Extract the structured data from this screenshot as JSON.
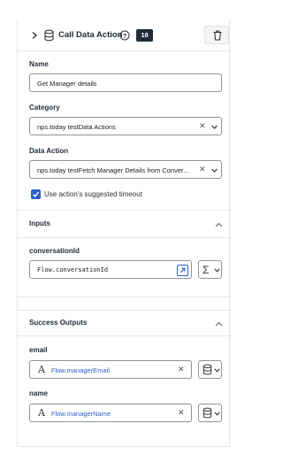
{
  "header": {
    "title": "Call Data Action",
    "badge": "18"
  },
  "form": {
    "name_label": "Name",
    "name_value": "Get Manager details",
    "category_label": "Category",
    "category_value": "nps.today testData Actions",
    "data_action_label": "Data Action",
    "data_action_value": "nps.today testFetch Manager Details from Conver...",
    "timeout_checked": true,
    "timeout_label": "Use action's suggested timeout"
  },
  "inputs": {
    "section_title": "Inputs",
    "items": [
      {
        "label": "conversationId",
        "value": "Flow.conversationId"
      }
    ]
  },
  "outputs": {
    "section_title": "Success Outputs",
    "items": [
      {
        "label": "email",
        "type_icon": "A",
        "value": "Flow.managerEmail"
      },
      {
        "label": "name",
        "type_icon": "A",
        "value": "Flow.managerName"
      }
    ]
  },
  "colors": {
    "accent": "#2b63c8",
    "badge_bg": "#1f2a37",
    "border": "#8b939d"
  }
}
